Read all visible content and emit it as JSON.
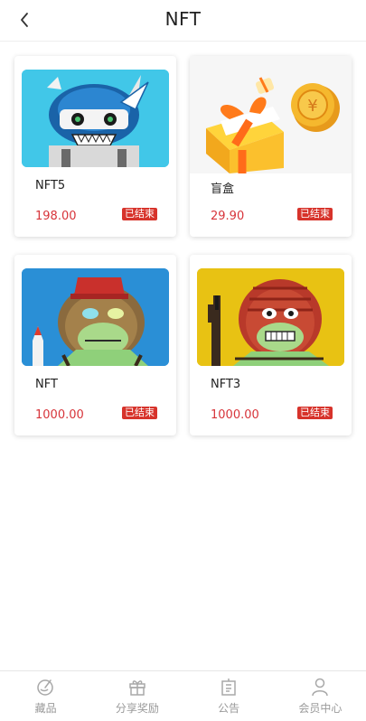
{
  "header": {
    "title": "NFT",
    "back_icon": "chevron-left-icon"
  },
  "products": [
    {
      "name": "NFT5",
      "price": "198.00",
      "status": "已结束",
      "image": "armored-robot-cartoon",
      "image_bg": "#41c7e8"
    },
    {
      "name": "盲盒",
      "price": "29.90",
      "status": "已结束",
      "image": "gift-box-with-coin",
      "image_bg": "#f6f6f6"
    },
    {
      "name": "NFT",
      "price": "1000.00",
      "status": "已结束",
      "image": "zombie-ape-with-fez",
      "image_bg": "#2a8fd6"
    },
    {
      "name": "NFT3",
      "price": "1000.00",
      "status": "已结束",
      "image": "zombie-ape-with-rifle",
      "image_bg": "#e8c213"
    }
  ],
  "tabbar": {
    "items": [
      {
        "label": "藏品",
        "icon": "collection-icon"
      },
      {
        "label": "分享奖励",
        "icon": "gift-icon"
      },
      {
        "label": "公告",
        "icon": "notice-icon"
      },
      {
        "label": "会员中心",
        "icon": "user-icon"
      }
    ]
  },
  "colors": {
    "price": "#d7343a",
    "badge": "#d7332b",
    "inactive_tab": "#9a9a9a"
  }
}
